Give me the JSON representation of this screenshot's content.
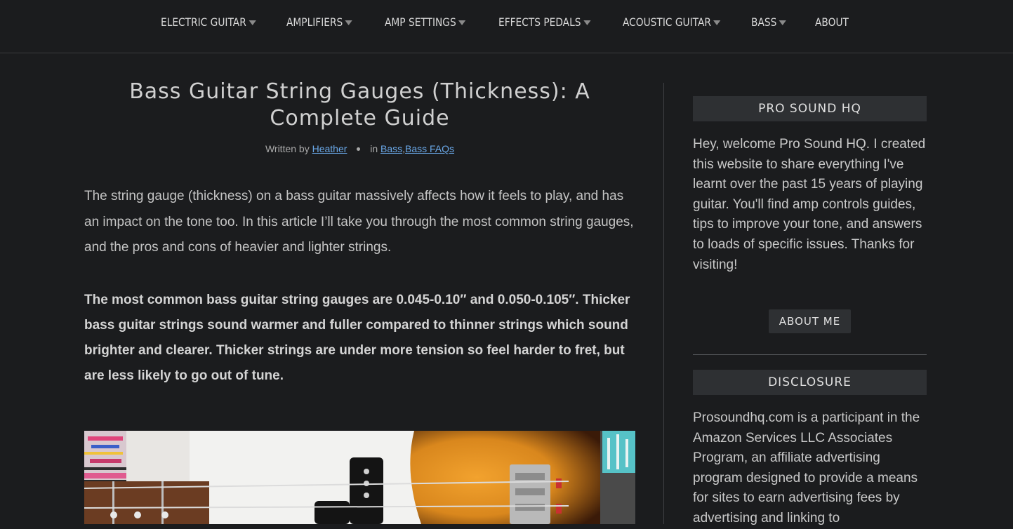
{
  "nav": {
    "items": [
      {
        "label": "ELECTRIC GUITAR",
        "dropdown": true
      },
      {
        "label": "AMPLIFIERS",
        "dropdown": true
      },
      {
        "label": "AMP SETTINGS",
        "dropdown": true
      },
      {
        "label": "EFFECTS PEDALS",
        "dropdown": true
      },
      {
        "label": "ACOUSTIC GUITAR",
        "dropdown": true
      },
      {
        "label": "BASS",
        "dropdown": true
      },
      {
        "label": "ABOUT",
        "dropdown": false
      }
    ]
  },
  "article": {
    "title": "Bass Guitar String Gauges (Thickness): A Complete Guide",
    "byline": {
      "written_by": "Written by",
      "author": "Heather",
      "in": "in",
      "category1": "Bass",
      "separator": ",",
      "category2": "Bass FAQs"
    },
    "intro": "The string gauge (thickness) on a bass guitar massively affects how it feels to play, and has an impact on the tone too. In this article I’ll take you through the most common string gauges, and the pros and cons of heavier and lighter strings.",
    "summary": "The most common bass guitar string gauges are 0.045-0.10″ and 0.050-0.105″. Thicker bass guitar strings sound warmer and fuller compared to thinner strings which sound brighter and clearer. Thicker strings are under more tension so feel harder to fret, but are less likely to go out of tune."
  },
  "sidebar": {
    "widget1": {
      "title": "PRO SOUND HQ",
      "text": "Hey, welcome Pro Sound HQ. I created this website to share everything I've learnt over the past 15 years of playing guitar. You'll find amp controls guides, tips to improve your tone, and answers to loads of specific issues. Thanks for visiting!",
      "button": "ABOUT ME"
    },
    "widget2": {
      "title": "DISCLOSURE",
      "text": "Prosoundhq.com is a participant in the Amazon Services LLC Associates Program, an affiliate advertising program designed to provide a means for sites to earn advertising fees by advertising and linking to"
    }
  },
  "colors": {
    "background": "#1b1c1e",
    "widget_header": "#2e3033",
    "link": "#6aa8e8",
    "sunburst": "#d9871d"
  }
}
